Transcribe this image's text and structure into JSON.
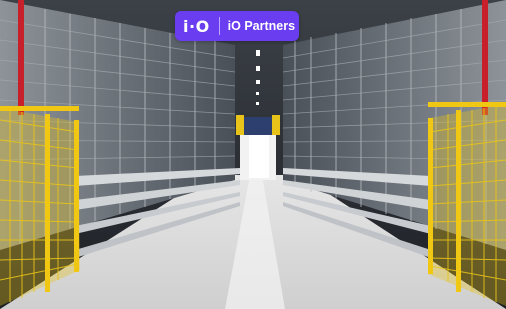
{
  "badge": {
    "logo": "i·O",
    "label": "iO Partners",
    "color": "#6a3df0"
  },
  "scene": {
    "subject": "warehouse-aisle",
    "colors": {
      "floor": "#dcdcdc",
      "racking": "#8a9096",
      "fence": "#e8c41a",
      "upright": "#c8202a",
      "far_wall": "#f2f2f2"
    }
  }
}
